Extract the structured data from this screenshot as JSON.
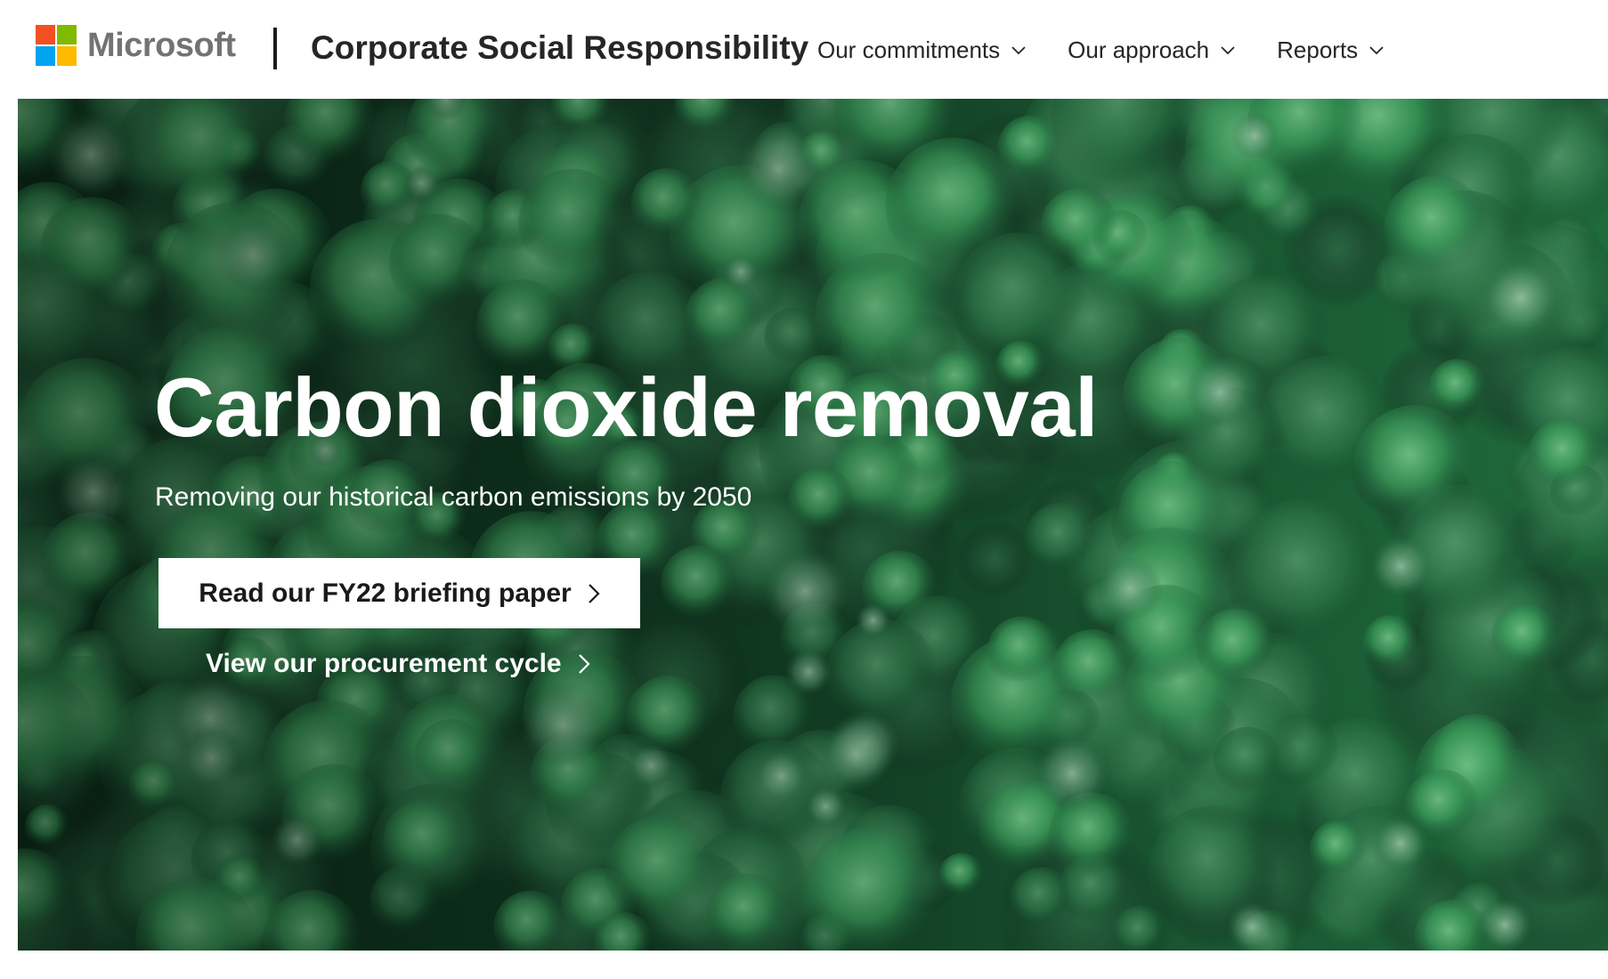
{
  "header": {
    "logo_text": "Microsoft",
    "logo_colors": [
      "#f25022",
      "#7fba00",
      "#00a4ef",
      "#ffb900"
    ],
    "site_title": "Corporate Social Responsibility",
    "nav": [
      {
        "label": "Our commitments",
        "icon": "chevron-down-icon"
      },
      {
        "label": "Our approach",
        "icon": "chevron-down-icon"
      },
      {
        "label": "Reports",
        "icon": "chevron-down-icon"
      }
    ]
  },
  "hero": {
    "background": "forest-canopy-aerial",
    "title": "Carbon dioxide removal",
    "subtitle": "Removing our historical carbon emissions by 2050",
    "primary_cta": {
      "label": "Read our FY22 briefing paper",
      "icon": "chevron-right-icon"
    },
    "secondary_cta": {
      "label": "View our procurement cycle",
      "icon": "chevron-right-icon"
    }
  },
  "colors": {
    "primary_text": "#262626",
    "hero_text": "#ffffff",
    "forest_dark": "#0f3a22",
    "forest_light": "#2f8a4e"
  }
}
